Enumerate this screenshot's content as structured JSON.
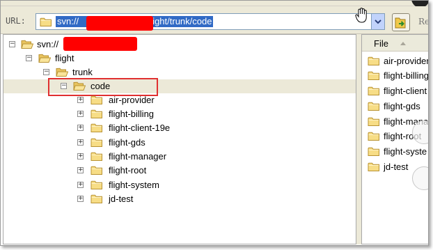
{
  "toolbar": {
    "url_label": "URL:",
    "url_value": "svn://            /flight/trunk/code",
    "url_prefix": "svn://",
    "url_suffix": "/flight/trunk/code",
    "re_label": "Re",
    "go_icon": "folder-go-icon",
    "dropdown_icon": "chevron-down-icon"
  },
  "tree": {
    "root": "svn://",
    "nodes": [
      {
        "label": "flight",
        "level": 1,
        "expander": "−"
      },
      {
        "label": "trunk",
        "level": 2,
        "expander": "−"
      },
      {
        "label": "code",
        "level": 3,
        "expander": "−",
        "selected": true
      },
      {
        "label": "air-provider",
        "level": 4,
        "expander": "+"
      },
      {
        "label": "flight-billing",
        "level": 4,
        "expander": "+"
      },
      {
        "label": "flight-client-19e",
        "level": 4,
        "expander": "+"
      },
      {
        "label": "flight-gds",
        "level": 4,
        "expander": "+"
      },
      {
        "label": "flight-manager",
        "level": 4,
        "expander": "+"
      },
      {
        "label": "flight-root",
        "level": 4,
        "expander": "+"
      },
      {
        "label": "flight-system",
        "level": 4,
        "expander": "+"
      },
      {
        "label": "jd-test",
        "level": 4,
        "expander": "+"
      }
    ]
  },
  "file_panel": {
    "header": "File",
    "files": [
      "air-provider",
      "flight-billing",
      "flight-client",
      "flight-gds",
      "flight-mana",
      "flight-root",
      "flight-syste",
      "jd-test"
    ]
  },
  "colors": {
    "selection_bg": "#316ac5",
    "redaction": "#ff0000",
    "highlight_border": "#e03030",
    "folder_fill": "#f5d77a"
  }
}
